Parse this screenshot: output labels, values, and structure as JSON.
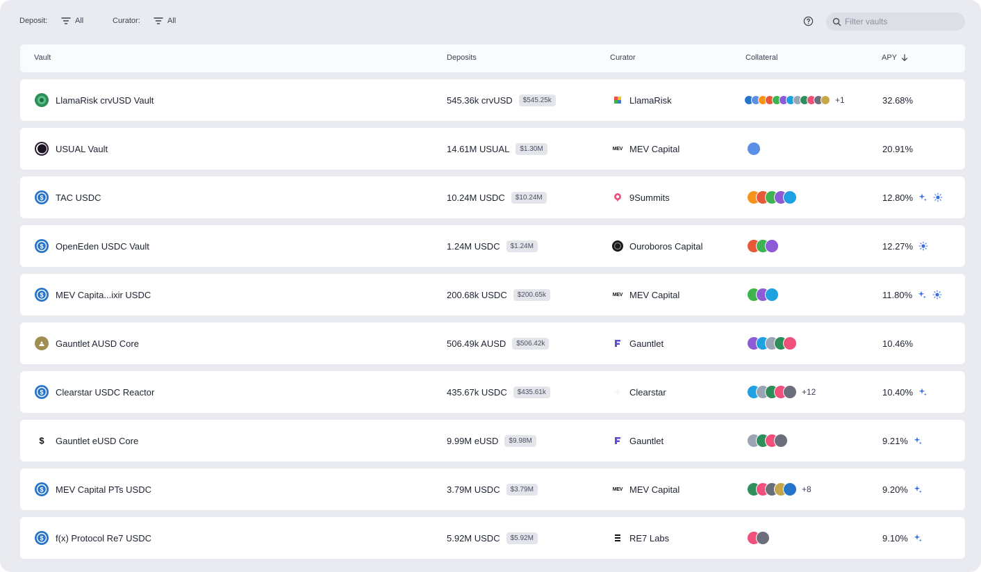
{
  "toolbar": {
    "deposit_label": "Deposit:",
    "deposit_value": "All",
    "curator_label": "Curator:",
    "curator_value": "All",
    "search_placeholder": "Filter vaults"
  },
  "table": {
    "headers": {
      "vault": "Vault",
      "deposits": "Deposits",
      "curator": "Curator",
      "collateral": "Collateral",
      "apy": "APY"
    },
    "sort": "apy-descending"
  },
  "colors": {
    "background": "#e9ebf0",
    "card": "#ffffff",
    "badge_bg": "#e3e5ea",
    "usdc_blue": "#2775ca",
    "sparkle_blue": "#3b6fe0"
  },
  "rows": [
    {
      "vault": "LlamaRisk crvUSD Vault",
      "vault_icon": "crvusd-icon",
      "deposit": "545.36k crvUSD",
      "deposit_usd": "$545.25k",
      "curator": "LlamaRisk",
      "curator_icon": "llamarisk-icon",
      "collateral_icons": [
        "token-icon",
        "token-icon",
        "token-icon",
        "token-icon",
        "token-icon",
        "token-icon",
        "token-icon",
        "token-icon",
        "token-icon",
        "token-icon",
        "token-icon",
        "token-icon"
      ],
      "collateral_more": "+1",
      "apy": "32.68%",
      "rewards": [],
      "stars": []
    },
    {
      "vault": "USUAL Vault",
      "vault_icon": "usual-icon",
      "deposit": "14.61M USUAL",
      "deposit_usd": "$1.30M",
      "curator": "MEV Capital",
      "curator_icon": "mev-capital-icon",
      "collateral_icons": [
        "usual-icon"
      ],
      "collateral_more": "",
      "apy": "20.91%"
    },
    {
      "vault": "TAC USDC",
      "vault_icon": "usdc-icon",
      "deposit": "10.24M USDC",
      "deposit_usd": "$10.24M",
      "curator": "9Summits",
      "curator_icon": "9summits-icon",
      "collateral_icons": [
        "token-icon",
        "token-icon",
        "token-icon",
        "token-icon",
        "btc-icon"
      ],
      "collateral_more": "",
      "apy": "12.80%",
      "sparkle": true,
      "sun": true
    },
    {
      "vault": "OpenEden USDC Vault",
      "vault_icon": "usdc-icon",
      "deposit": "1.24M USDC",
      "deposit_usd": "$1.24M",
      "curator": "Ouroboros Capital",
      "curator_icon": "ouroboros-icon",
      "collateral_icons": [
        "token-icon",
        "token-icon",
        "token-icon"
      ],
      "collateral_more": "",
      "apy": "12.27%",
      "sparkle": false,
      "sun": true
    },
    {
      "vault": "MEV Capita...ixir USDC",
      "vault_icon": "usdc-icon",
      "deposit": "200.68k USDC",
      "deposit_usd": "$200.65k",
      "curator": "MEV Capital",
      "curator_icon": "mev-capital-icon",
      "collateral_icons": [
        "token-icon",
        "btc-icon",
        "token-icon"
      ],
      "collateral_more": "",
      "apy": "11.80%",
      "sparkle": true,
      "sun": true
    },
    {
      "vault": "Gauntlet AUSD Core",
      "vault_icon": "ausd-icon",
      "deposit": "506.49k AUSD",
      "deposit_usd": "$506.42k",
      "curator": "Gauntlet",
      "curator_icon": "gauntlet-icon",
      "collateral_icons": [
        "token-icon",
        "token-icon",
        "token-icon",
        "token-icon",
        "btc-icon"
      ],
      "collateral_more": "",
      "apy": "10.46%"
    },
    {
      "vault": "Clearstar USDC Reactor",
      "vault_icon": "usdc-icon",
      "deposit": "435.67k USDC",
      "deposit_usd": "$435.61k",
      "curator": "Clearstar",
      "curator_icon": "clearstar-icon",
      "collateral_icons": [
        "token-icon",
        "token-icon",
        "token-icon",
        "token-icon",
        "token-icon"
      ],
      "collateral_more": "+12",
      "apy": "10.40%",
      "sparkle": true
    },
    {
      "vault": "Gauntlet eUSD Core",
      "vault_icon": "eusd-icon",
      "deposit": "9.99M eUSD",
      "deposit_usd": "$9.98M",
      "curator": "Gauntlet",
      "curator_icon": "gauntlet-icon",
      "collateral_icons": [
        "token-icon",
        "token-icon",
        "btc-icon",
        "eth-icon"
      ],
      "collateral_more": "",
      "apy": "9.21%",
      "sparkle": true
    },
    {
      "vault": "MEV Capital PTs USDC",
      "vault_icon": "usdc-icon",
      "deposit": "3.79M USDC",
      "deposit_usd": "$3.79M",
      "curator": "MEV Capital",
      "curator_icon": "mev-capital-icon",
      "collateral_icons": [
        "token-icon",
        "token-icon",
        "token-icon",
        "token-icon",
        "token-icon"
      ],
      "collateral_more": "+8",
      "apy": "9.20%",
      "sparkle": true
    },
    {
      "vault": "f(x) Protocol Re7 USDC",
      "vault_icon": "usdc-icon",
      "deposit": "5.92M USDC",
      "deposit_usd": "$5.92M",
      "curator": "RE7 Labs",
      "curator_icon": "re7-labs-icon",
      "collateral_icons": [
        "token-icon",
        "token-icon"
      ],
      "collateral_more": "",
      "apy": "9.10%",
      "sparkle": true
    }
  ]
}
